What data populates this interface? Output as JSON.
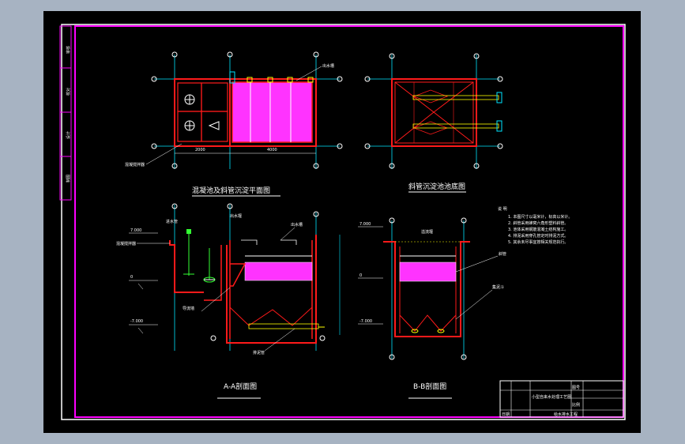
{
  "viewport": {
    "background": "#000000",
    "outside_color": "#a7b3c2"
  },
  "colors": {
    "frame_magenta": "#ff00ff",
    "wall_red": "#ff1a1a",
    "axis_cyan": "#00e5ff",
    "fill_magenta": "#ff33ff",
    "text_white": "#ffffff",
    "accent_yellow": "#ffff00",
    "accent_green": "#33ff33"
  },
  "views": {
    "plan": {
      "title": "混凝池及斜管沉淀平面图"
    },
    "bottom": {
      "title": "斜管沉淀池池底图"
    },
    "section_a": {
      "title": "A-A剖面图"
    },
    "section_b": {
      "title": "B-B剖面图"
    }
  },
  "labels": {
    "outlet_weir": "出水槽",
    "mixer": "混凝搅拌器",
    "inlet_pipe": "进水管",
    "sludge_pipe": "排泥管",
    "tube": "斜管",
    "overflow": "溢流堰",
    "baffle": "导流墙",
    "side_weir": "出水堰",
    "inlet_flow": "出水管",
    "slope": "集泥斗",
    "elev_top": "7.000",
    "elev_mid": "0",
    "elev_bot": "-7.000",
    "dim_left": "2000",
    "dim_right": "4000"
  },
  "notes": {
    "heading": "说 明",
    "items": [
      "1. 本图尺寸以毫米计，标高以米计。",
      "2. 斜管采用蜂窝六角形塑料斜管。",
      "3. 池体采用钢筋混凝土结构施工。",
      "4. 排泥采用穿孔管定时排泥方式。",
      "5. 其余未尽事宜按相关规范执行。"
    ]
  },
  "side_labels": [
    "审核",
    "校对",
    "设计",
    "制图"
  ],
  "title_block": {
    "project": "小型自来水处理工艺图",
    "sheet_no": "图号",
    "scale": "比例",
    "school": "给水排水工程",
    "date": "日期"
  }
}
